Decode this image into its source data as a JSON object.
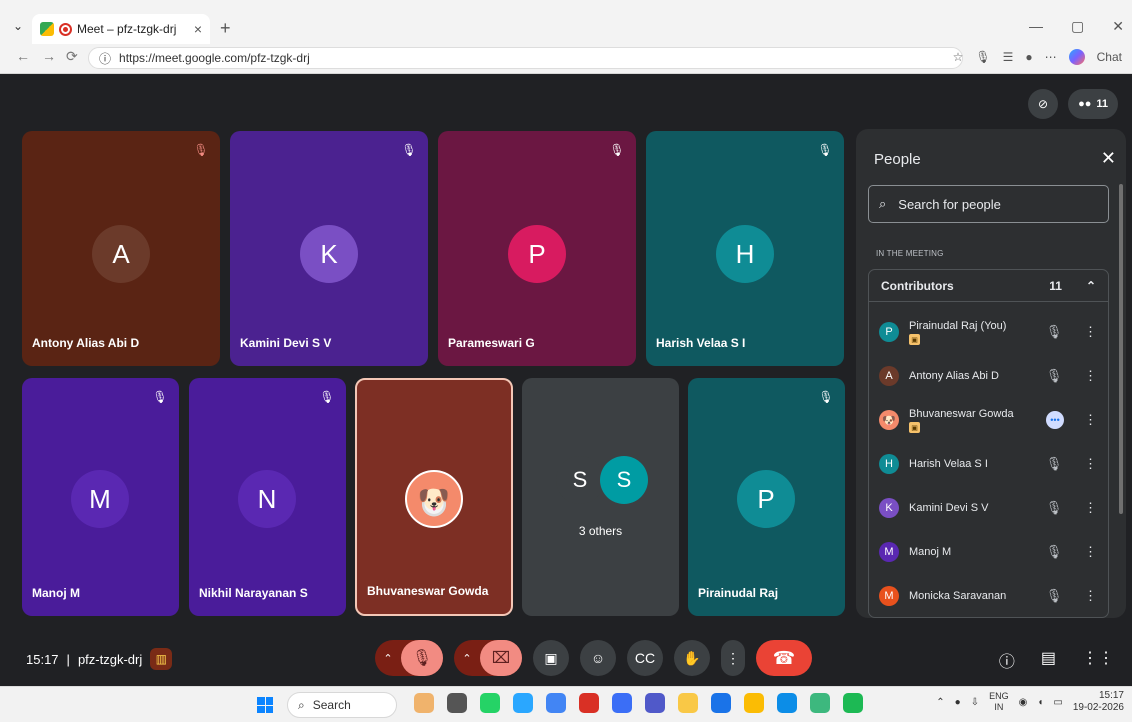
{
  "browser": {
    "tab_title": "Meet – pfz-tzgk-drj",
    "tab_close": "×",
    "new_tab": "+",
    "url": "https://meet.google.com/pfz-tzgk-drj",
    "copilot_label": "Chat"
  },
  "meet": {
    "participants_count": "11",
    "tiles": [
      {
        "name": "Antony Alias Abi D",
        "initial": "A",
        "bg": "#5a2414",
        "avatar_bg": "#6b3a2a"
      },
      {
        "name": "Kamini Devi S V",
        "initial": "K",
        "bg": "#4b2290",
        "avatar_bg": "#7a4fc4"
      },
      {
        "name": "Parameswari G",
        "initial": "P",
        "bg": "#6b1742",
        "avatar_bg": "#d81b60"
      },
      {
        "name": "Harish Velaa S I",
        "initial": "H",
        "bg": "#0f5960",
        "avatar_bg": "#0f8c95"
      },
      {
        "name": "Manoj M",
        "initial": "M",
        "bg": "#4a1c9a",
        "avatar_bg": "#5a28b2"
      },
      {
        "name": "Nikhil Narayanan S",
        "initial": "N",
        "bg": "#4a1c9a",
        "avatar_bg": "#5a28b2"
      },
      {
        "name": "Bhuvaneswar Gowda",
        "initial": "",
        "bg": "#7d2f24",
        "avatar_bg": "#f48a6b"
      },
      {
        "name": "",
        "initial": "",
        "bg": "#3c4043",
        "avatar_bg": "#3c4043"
      },
      {
        "name": "Pirainudal Raj",
        "initial": "P",
        "bg": "#0f5960",
        "avatar_bg": "#0f8c95"
      }
    ],
    "others": {
      "avatar_1": "S",
      "avatar_2": "S",
      "label": "3 others"
    },
    "time": "15:17",
    "meeting_code": "pfz-tzgk-drj"
  },
  "people_panel": {
    "title": "People",
    "search_placeholder": "Search for people",
    "section_label": "IN THE MEETING",
    "contributors_label": "Contributors",
    "contributors_count": "11",
    "people": [
      {
        "initial": "P",
        "name": "Pirainudal Raj (You)",
        "color": "#0f8c95",
        "host": true,
        "speaking": false
      },
      {
        "initial": "A",
        "name": "Antony Alias Abi D",
        "color": "#6b3a2a",
        "host": false,
        "speaking": false
      },
      {
        "initial": "",
        "name": "Bhuvaneswar Gowda",
        "color": "#f48a6b",
        "host": true,
        "speaking": true
      },
      {
        "initial": "H",
        "name": "Harish Velaa S I",
        "color": "#0f8c95",
        "host": false,
        "speaking": false
      },
      {
        "initial": "K",
        "name": "Kamini Devi S V",
        "color": "#7a4fc4",
        "host": false,
        "speaking": false
      },
      {
        "initial": "M",
        "name": "Manoj M",
        "color": "#5a28b2",
        "host": false,
        "speaking": false
      },
      {
        "initial": "M",
        "name": "Monicka Saravanan",
        "color": "#e8511d",
        "host": false,
        "speaking": false
      }
    ]
  },
  "taskbar": {
    "search_label": "Search",
    "lang_1": "ENG",
    "lang_2": "IN",
    "time": "15:17",
    "date": "19-02-2026"
  }
}
